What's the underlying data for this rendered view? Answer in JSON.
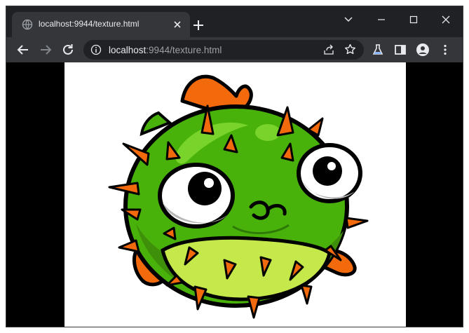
{
  "browser": {
    "tab": {
      "title": "localhost:9944/texture.html",
      "favicon": "globe-icon"
    },
    "address_bar": {
      "host": "localhost",
      "rest": ":9944/texture.html"
    },
    "icons": {
      "back": "back-arrow-icon",
      "forward": "forward-arrow-icon",
      "reload": "reload-icon",
      "info": "info-icon",
      "share": "share-icon",
      "bookmark": "star-icon",
      "labs": "flask-icon",
      "sidepanel": "side-panel-icon",
      "profile": "profile-icon",
      "menu": "kebab-menu-icon",
      "new_tab": "plus-icon",
      "tab_search": "chevron-down-icon",
      "minimize": "minimize-icon",
      "maximize": "maximize-icon",
      "close": "close-icon"
    }
  },
  "page": {
    "content": "pufferfish-texture",
    "colors": {
      "page_background": "#000000",
      "canvas_background": "#ffffff",
      "body_green": "#49b20a",
      "belly_yellow": "#c5e84a",
      "fin_orange": "#f26a0c",
      "outline": "#000000"
    }
  }
}
